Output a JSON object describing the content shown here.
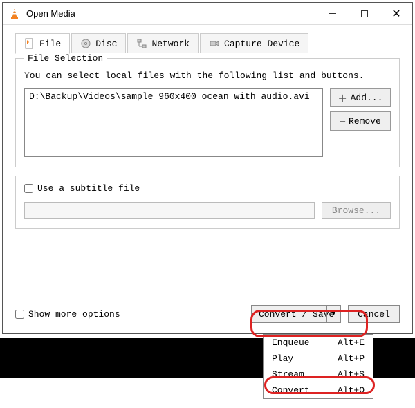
{
  "window": {
    "title": "Open Media"
  },
  "tabs": {
    "file": "File",
    "disc": "Disc",
    "network": "Network",
    "capture": "Capture Device"
  },
  "file_selection": {
    "legend": "File Selection",
    "help": "You can select local files with the following list and buttons.",
    "files": [
      "D:\\Backup\\Videos\\sample_960x400_ocean_with_audio.avi"
    ],
    "add_label": "Add...",
    "remove_label": "Remove"
  },
  "subtitle": {
    "checkbox_label": "Use a subtitle file",
    "browse_label": "Browse..."
  },
  "show_more_label": "Show more options",
  "convert_save_label": "Convert / Save",
  "cancel_label": "Cancel",
  "dropdown": {
    "enqueue": {
      "label": "Enqueue",
      "shortcut": "Alt+E"
    },
    "play": {
      "label": "Play",
      "shortcut": "Alt+P"
    },
    "stream": {
      "label": "Stream",
      "shortcut": "Alt+S"
    },
    "convert": {
      "label": "Convert",
      "shortcut": "Alt+O"
    }
  }
}
